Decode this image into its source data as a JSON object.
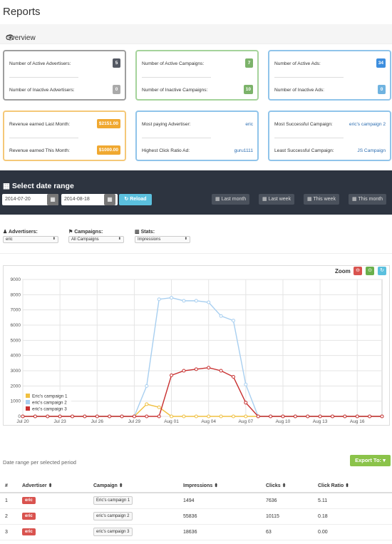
{
  "page": {
    "title": "Reports",
    "overview_label": "Overview"
  },
  "cards": [
    {
      "r1_label": "Number of Active Advertisers:",
      "r1_value": "5",
      "r2_label": "Number of Inactive Advertisers:",
      "r2_value": "0",
      "r1_color": "#555a64",
      "r2_color": "#aaaaaa",
      "border": "#9e9e9e"
    },
    {
      "r1_label": "Number of Active Campaigns:",
      "r1_value": "7",
      "r2_label": "Number of Inactive Campaigns:",
      "r2_value": "10",
      "r1_color": "#7cb36a",
      "r2_color": "#7cb36a",
      "border": "#a5d39b"
    },
    {
      "r1_label": "Number of Active Ads:",
      "r1_value": "34",
      "r2_label": "Number of Inactive Ads:",
      "r2_value": "0",
      "r1_color": "#3d8ede",
      "r2_color": "#6fb3e0",
      "border": "#90c4ea"
    },
    {
      "r1_label": "Revenue earned Last Month:",
      "r1_value": "$2151.00",
      "r2_label": "Revenue earned This Month:",
      "r2_value": "$1000.00",
      "r1_color": "#f0a830",
      "r2_color": "#f0a830",
      "border": "#f5c878"
    },
    {
      "r1_label": "Most paying Advertiser:",
      "r1_value": "eric",
      "r2_label": "Highest Click Ratio Ad:",
      "r2_value": "guru1111",
      "border": "#90c4ea"
    },
    {
      "r1_label": "Most Successful Campaign:",
      "r1_value": "eric's campaign 2",
      "r2_label": "Least Successful Campaign:",
      "r2_value": "JS Campaign",
      "border": "#90c4ea"
    }
  ],
  "daterange": {
    "title": "Select date range",
    "start": "2014-07-20",
    "end": "2014-08-18",
    "reload": "Reload",
    "last_month": "Last month",
    "last_week": "Last week",
    "this_week": "This week",
    "this_month": "This month"
  },
  "filters": {
    "advertisers_label": "Advertisers:",
    "advertisers_value": "eric",
    "campaigns_label": "Campaigns:",
    "campaigns_value": "All Campaigns",
    "stats_label": "Stats:",
    "stats_value": "Impressions"
  },
  "chart": {
    "zoom_label": "Zoom"
  },
  "chart_data": {
    "type": "line",
    "x": [
      "Jul 20",
      "Jul 21",
      "Jul 22",
      "Jul 23",
      "Jul 24",
      "Jul 25",
      "Jul 26",
      "Jul 27",
      "Jul 28",
      "Jul 29",
      "Jul 30",
      "Jul 31",
      "Aug 01",
      "Aug 02",
      "Aug 03",
      "Aug 04",
      "Aug 05",
      "Aug 06",
      "Aug 07",
      "Aug 08",
      "Aug 09",
      "Aug 10",
      "Aug 11",
      "Aug 12",
      "Aug 13",
      "Aug 14",
      "Aug 15",
      "Aug 16",
      "Aug 17",
      "Aug 18"
    ],
    "xticks": [
      "Jul 20",
      "Jul 23",
      "Jul 26",
      "Jul 29",
      "Aug 01",
      "Aug 04",
      "Aug 07",
      "Aug 10",
      "Aug 13",
      "Aug 16"
    ],
    "ylim": [
      0,
      9000
    ],
    "yticks": [
      0,
      1000,
      2000,
      3000,
      4000,
      5000,
      6000,
      7000,
      8000,
      9000
    ],
    "series": [
      {
        "name": "Eric's campaign 1",
        "color": "#f0c040",
        "values": [
          0,
          0,
          0,
          0,
          0,
          0,
          0,
          0,
          0,
          0,
          800,
          600,
          0,
          0,
          0,
          0,
          0,
          0,
          0,
          0,
          0,
          0,
          0,
          0,
          0,
          0,
          0,
          0,
          0,
          0
        ]
      },
      {
        "name": "eric's campaign 2",
        "color": "#a8cff0",
        "values": [
          0,
          0,
          0,
          0,
          0,
          0,
          0,
          0,
          0,
          0,
          2000,
          7700,
          7800,
          7600,
          7600,
          7500,
          6600,
          6300,
          2100,
          0,
          0,
          0,
          0,
          0,
          0,
          0,
          0,
          0,
          0,
          0
        ]
      },
      {
        "name": "eric's campaign 3",
        "color": "#c83030",
        "values": [
          0,
          0,
          0,
          0,
          0,
          0,
          0,
          0,
          0,
          0,
          0,
          0,
          2700,
          3000,
          3100,
          3200,
          3000,
          2600,
          900,
          0,
          0,
          0,
          0,
          0,
          0,
          0,
          0,
          0,
          0,
          0
        ]
      }
    ],
    "legend": "bottom-left",
    "grid": true
  },
  "table": {
    "range_label": "Date range per selected period",
    "export_label": "Export To:",
    "headers": [
      "#",
      "Advertiser",
      "Campaign",
      "Impressions",
      "Clicks",
      "Click Ratio"
    ],
    "rows": [
      {
        "n": "1",
        "adv": "eric",
        "camp": "Eric's campaign 1",
        "imp": "1494",
        "clicks": "7636",
        "ratio": "5.11"
      },
      {
        "n": "2",
        "adv": "eric",
        "camp": "eric's campaign 2",
        "imp": "55836",
        "clicks": "10115",
        "ratio": "0.18"
      },
      {
        "n": "3",
        "adv": "eric",
        "camp": "eric's campaign 3",
        "imp": "18636",
        "clicks": "63",
        "ratio": "0.00"
      }
    ]
  }
}
